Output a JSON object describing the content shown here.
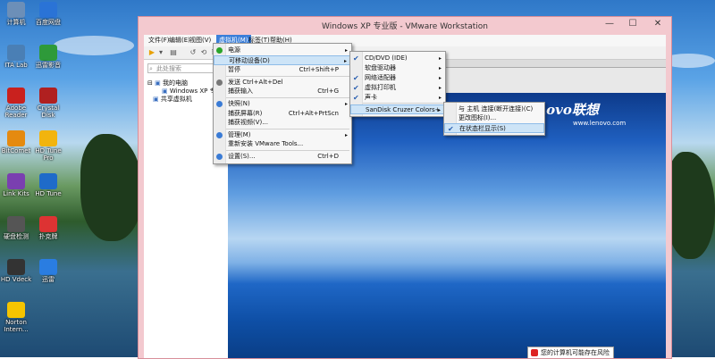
{
  "desktop": {
    "icons": [
      {
        "label": "计算机",
        "color": "#6c8fb8"
      },
      {
        "label": "百度网盘",
        "color": "#2a73d6"
      },
      {
        "label": "ITA Lab",
        "color": "#4a7fb5"
      },
      {
        "label": "迅雷影音",
        "color": "#2e9a3a"
      },
      {
        "label": "Adobe Reader",
        "color": "#c9211e"
      },
      {
        "label": "Crystal Disk",
        "color": "#b02020"
      },
      {
        "label": "BitComet",
        "color": "#e58a10"
      },
      {
        "label": "HD Tune Pro",
        "color": "#f2b40e"
      },
      {
        "label": "Link Kits",
        "color": "#7a3fb0"
      },
      {
        "label": "HD Tune",
        "color": "#1f6bc9"
      },
      {
        "label": "硬盘检测",
        "color": "#555555"
      },
      {
        "label": "扑克牌",
        "color": "#d33"
      },
      {
        "label": "HD Vdeck",
        "color": "#333"
      },
      {
        "label": "迅雷",
        "color": "#2a7de1"
      },
      {
        "label": "Norton Intern...",
        "color": "#f5c400"
      }
    ]
  },
  "window": {
    "title": "Windows XP 专业版 - VMware Workstation",
    "controls": {
      "minimize": "—",
      "maximize": "☐",
      "close": "✕"
    }
  },
  "menubar": {
    "items": [
      "文件(F)",
      "编辑(E)",
      "视图(V)",
      "虚拟机(M)",
      "标签(T)",
      "帮助(H)"
    ],
    "active_index": 3
  },
  "library": {
    "search_placeholder": "此处搜索",
    "tree": {
      "my_computer": "我的电脑",
      "vm": "Windows XP 专业",
      "shared": "共享虚拟机"
    }
  },
  "guest": {
    "logo": "lenovo联想",
    "url": "www.lenovo.com",
    "security_tip": "您的计算机可能存在风险"
  },
  "vm_menu": {
    "items": [
      {
        "label": "电源",
        "shortcut": "",
        "arrow": true,
        "icon_color": "#2aa52a"
      },
      {
        "label": "可移动设备(D)",
        "shortcut": "",
        "arrow": true,
        "icon_color": ""
      },
      {
        "label": "暂停",
        "shortcut": "Ctrl+Shift+P",
        "arrow": false,
        "icon_color": ""
      },
      {
        "label": "发送 Ctrl+Alt+Del",
        "shortcut": "",
        "arrow": false,
        "icon_color": "#777"
      },
      {
        "label": "捕获输入",
        "shortcut": "Ctrl+G",
        "arrow": false,
        "icon_color": ""
      },
      {
        "label": "快照(N)",
        "shortcut": "",
        "arrow": true,
        "icon_color": "#3a7bd5"
      },
      {
        "label": "捕获屏幕(R)",
        "shortcut": "Ctrl+Alt+PrtScn",
        "arrow": false,
        "icon_color": ""
      },
      {
        "label": "捕获视频(V)...",
        "shortcut": "",
        "arrow": false,
        "icon_color": ""
      },
      {
        "label": "管理(M)",
        "shortcut": "",
        "arrow": true,
        "icon_color": "#3a7bd5"
      },
      {
        "label": "重新安装 VMware Tools...",
        "shortcut": "",
        "arrow": false,
        "icon_color": ""
      },
      {
        "label": "设置(S)...",
        "shortcut": "Ctrl+D",
        "arrow": false,
        "icon_color": "#3a7bd5"
      }
    ]
  },
  "devices_menu": {
    "items": [
      {
        "label": "CD/DVD (IDE)",
        "checked": true
      },
      {
        "label": "软盘驱动器",
        "checked": false
      },
      {
        "label": "网络适配器",
        "checked": true
      },
      {
        "label": "虚拟打印机",
        "checked": true
      },
      {
        "label": "声卡",
        "checked": true
      },
      {
        "label": "SanDisk Cruzer Colors+",
        "checked": false
      }
    ]
  },
  "usb_menu": {
    "items": [
      {
        "label": "与 主机 连接(断开连接)(C)",
        "checked": false
      },
      {
        "label": "更改图标(I)...",
        "checked": false
      },
      {
        "label": "在状态栏显示(S)",
        "checked": true
      }
    ]
  },
  "glyphs": {
    "arrow": "▸",
    "check": "✔",
    "search": "⌕",
    "expand": "⊟",
    "chev": "▾"
  }
}
